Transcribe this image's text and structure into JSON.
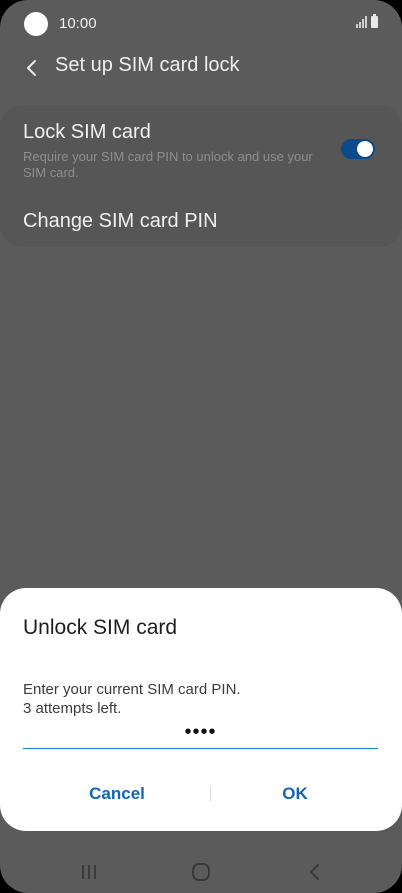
{
  "status_bar": {
    "time": "10:00",
    "icons": [
      "camera-icon",
      "signal-icon",
      "battery-icon"
    ]
  },
  "header": {
    "back_icon": "back-arrow-icon",
    "title": "Set up SIM card lock"
  },
  "settings": {
    "lock_sim": {
      "label": "Lock SIM card",
      "description": "Require your SIM card PIN to unlock and use your SIM card.",
      "toggle_on": true
    },
    "change_pin": {
      "label": "Change SIM card PIN"
    }
  },
  "dialog": {
    "title": "Unlock SIM card",
    "message_line1": "Enter your current SIM card PIN.",
    "message_line2": "3 attempts left.",
    "pin_value": "••••",
    "cancel_label": "Cancel",
    "ok_label": "OK"
  },
  "navigation": {
    "items": [
      "recent-apps-icon",
      "home-icon",
      "back-icon"
    ]
  },
  "colors": {
    "background_dim": "#5b5b5b",
    "accent": "#1464b7",
    "toggle_active": "#0e4a8a",
    "input_underline": "#1a7fd8"
  }
}
